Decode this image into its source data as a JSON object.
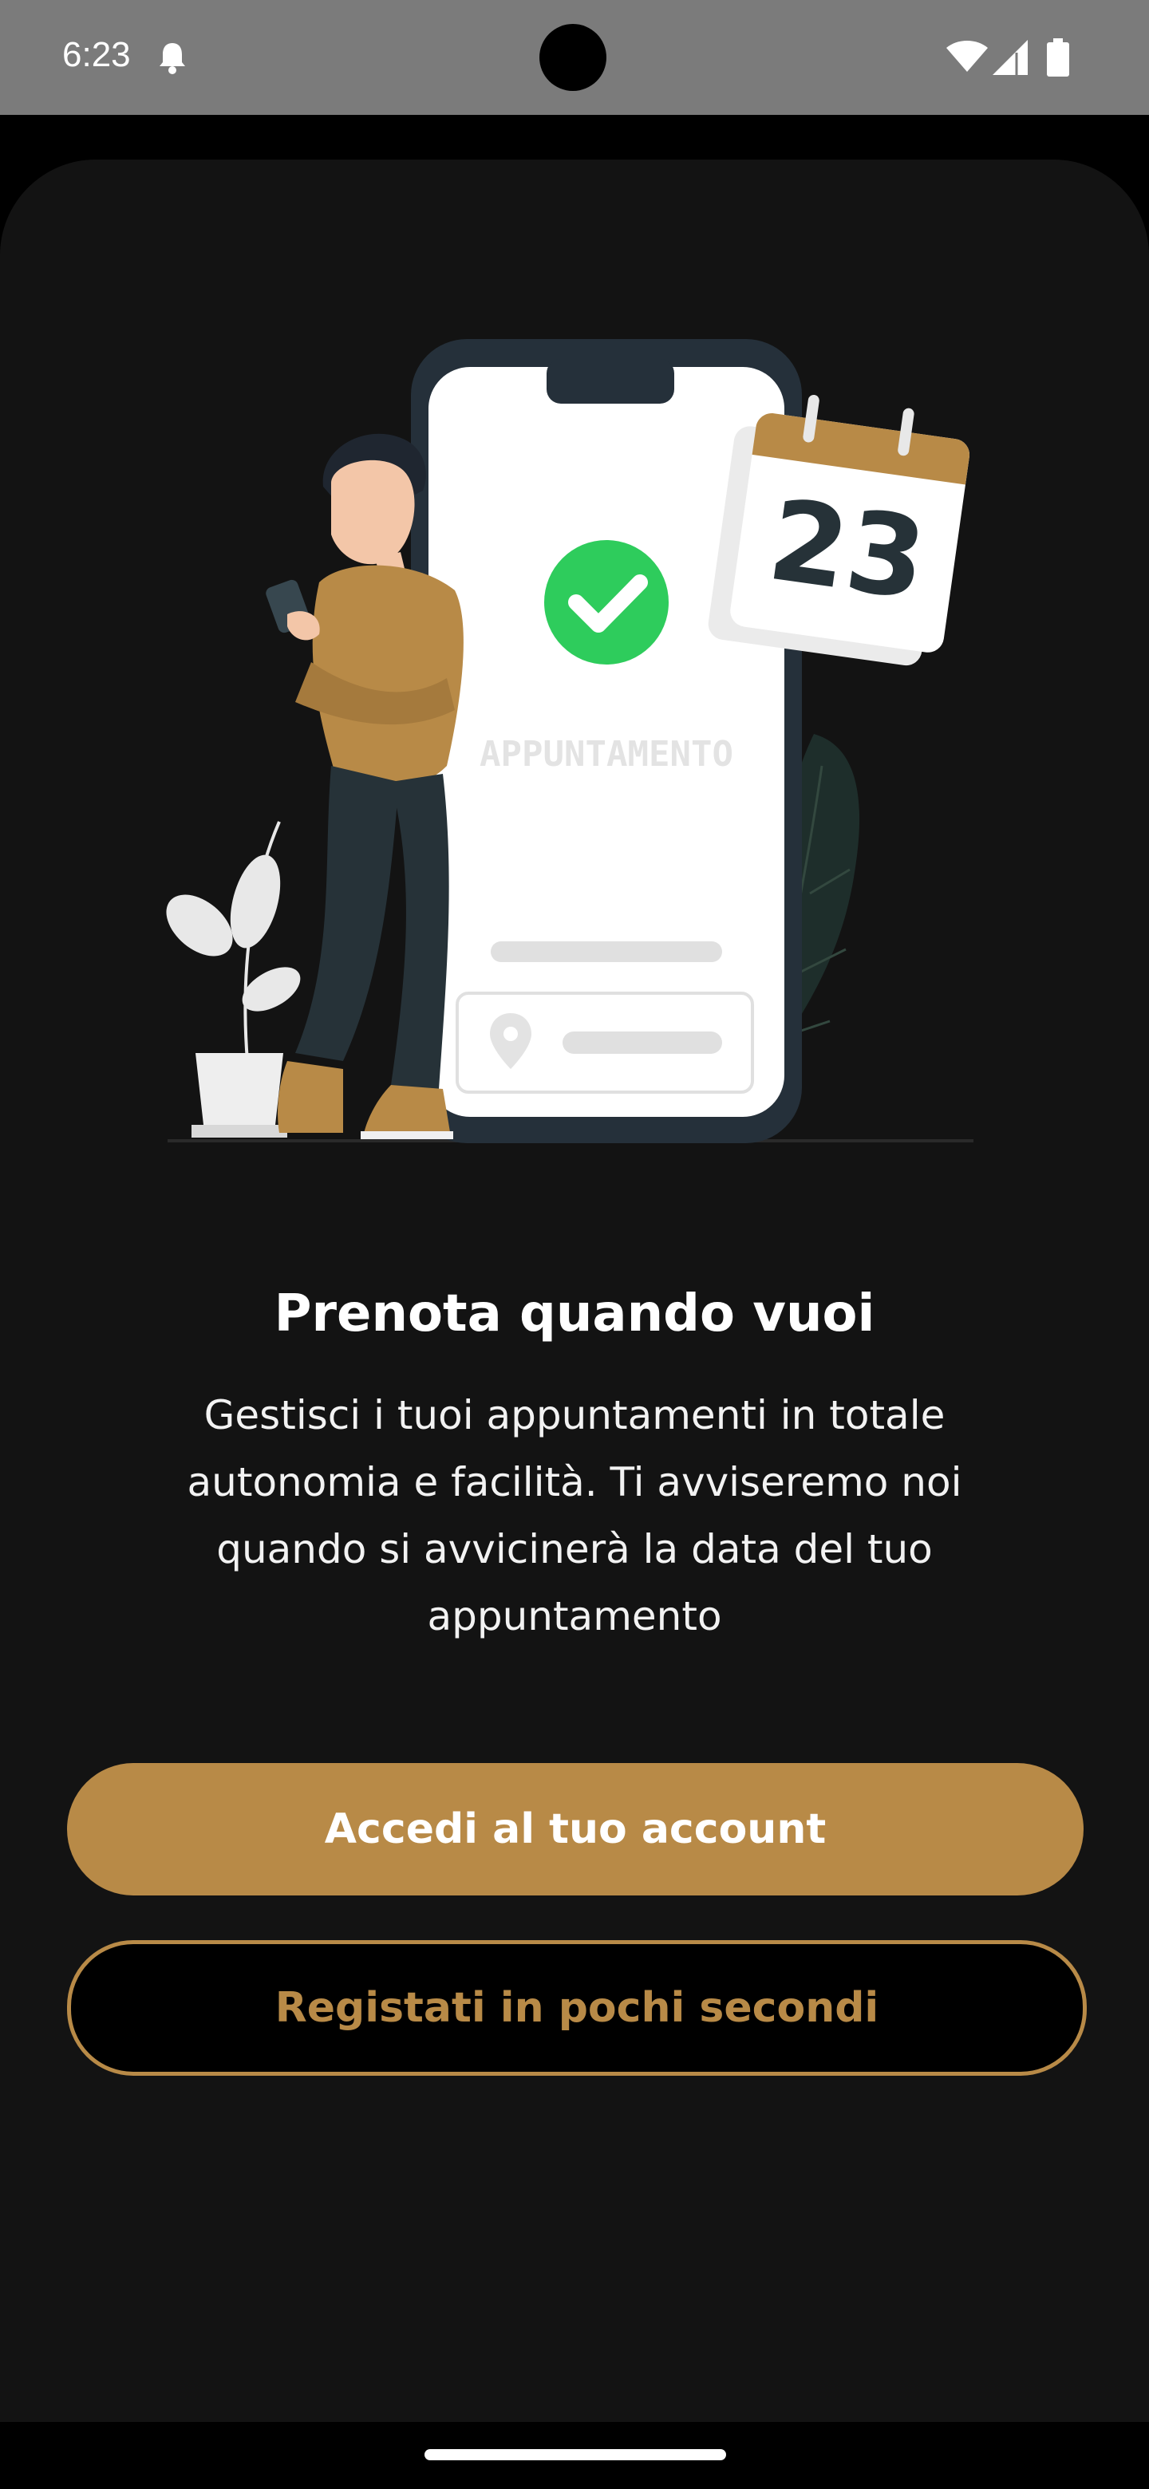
{
  "status_bar": {
    "time": "6:23",
    "icons": [
      "bell-icon",
      "wifi-icon",
      "signal-icon",
      "battery-icon"
    ]
  },
  "illustration": {
    "phone_label": "APPUNTAMENTO",
    "calendar_day": "23"
  },
  "onboarding": {
    "title": "Prenota quando vuoi",
    "description": "Gestisci i tuoi appuntamenti in totale autonomia e facilità. Ti avviseremo noi quando si avvicinerà la data del tuo appuntamento"
  },
  "actions": {
    "login_label": "Accedi al tuo account",
    "register_label": "Registati in pochi secondi"
  },
  "colors": {
    "accent": "#b88a47",
    "background": "#131313",
    "status_bar": "#7b7b7b",
    "success": "#2ecc5c"
  }
}
